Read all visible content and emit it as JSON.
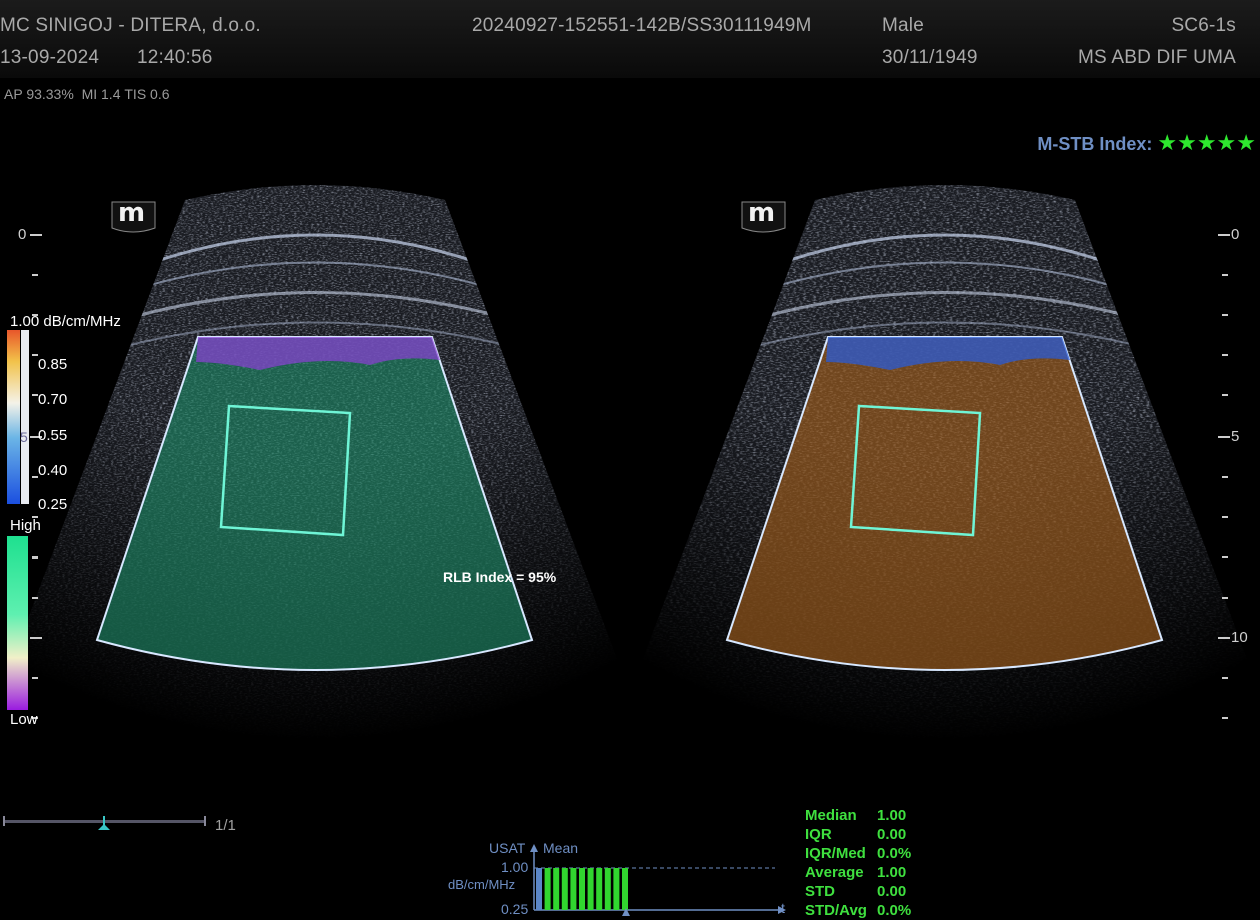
{
  "header": {
    "clinic": "MC SINIGOJ - DITERA, d.o.o.",
    "date": "13-09-2024",
    "time": "12:40:56",
    "exam_id": "20240927-152551-142B/SS30111949M",
    "sex": "Male",
    "birth_date": "30/11/1949",
    "probe": "SC6-1s",
    "preset": "MS ABD DIF UMA"
  },
  "params": {
    "ap": "AP 93.33%",
    "mi": "MI 1.4",
    "tis": "TIS 0.6"
  },
  "stb": {
    "label": "M-STB Index:",
    "stars": "★★★★★",
    "rating": 5
  },
  "logo": {
    "symbol": "m"
  },
  "depth_scale": {
    "label_0": "0",
    "label_5": "5",
    "label_10": "10"
  },
  "attenuation_bar": {
    "unit_label": "1.00 dB/cm/MHz",
    "ticks": [
      "0.85",
      "0.70",
      "0.55",
      "0.40",
      "0.25"
    ],
    "overlap_mark": "5"
  },
  "quality_bar": {
    "high": "High",
    "low": "Low"
  },
  "rlb_index": "RLB Index = 95%",
  "cine": {
    "frame": "1/1"
  },
  "usat_chart": {
    "title": "USAT",
    "mean_label": "Mean",
    "top_value": "1.00",
    "unit": "dB/cm/MHz",
    "bottom_value": "0.25",
    "t_label": "t"
  },
  "chart_data": {
    "type": "bar",
    "title": "USAT",
    "ylabel": "dB/cm/MHz",
    "ylim": [
      0.25,
      1.0
    ],
    "series": [
      {
        "name": "Mean",
        "values": [
          1.0,
          1.0,
          1.0,
          1.0,
          1.0,
          1.0,
          1.0,
          1.0,
          1.0,
          1.0,
          1.0
        ]
      }
    ],
    "first_bar_color": "#5b86c8",
    "bar_color": "#31d62f"
  },
  "stats": [
    {
      "label": "Median",
      "value": "1.00"
    },
    {
      "label": "IQR",
      "value": "0.00"
    },
    {
      "label": "IQR/Med",
      "value": "0.0%"
    },
    {
      "label": "Average",
      "value": "1.00"
    },
    {
      "label": "STD",
      "value": "0.00"
    },
    {
      "label": "STD/Avg",
      "value": "0.0%"
    }
  ],
  "colors": {
    "stars": "#2ee82e",
    "roi_box": "#6ff5d6",
    "sector_outline": "#d8e8ff",
    "left_overlay": "#1f8a68",
    "right_overlay": "#9a5a1c"
  }
}
